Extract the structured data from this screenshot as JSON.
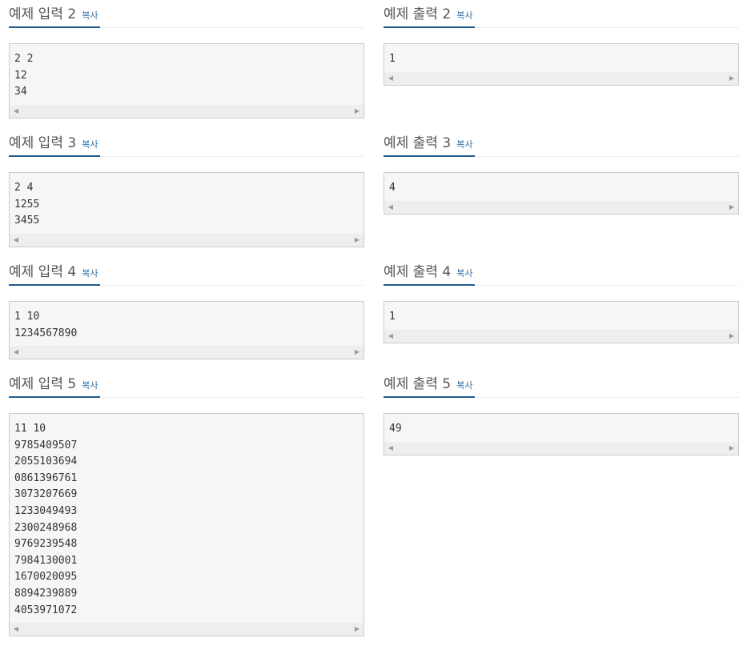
{
  "copy_label": "복사",
  "arrows": {
    "left_glyph": "◀",
    "right_glyph": "▶"
  },
  "samples": [
    {
      "input_title": "예제 입력 2",
      "output_title": "예제 출력 2",
      "input": "2 2\n12\n34",
      "output": "1"
    },
    {
      "input_title": "예제 입력 3",
      "output_title": "예제 출력 3",
      "input": "2 4\n1255\n3455",
      "output": "4"
    },
    {
      "input_title": "예제 입력 4",
      "output_title": "예제 출력 4",
      "input": "1 10\n1234567890",
      "output": "1"
    },
    {
      "input_title": "예제 입력 5",
      "output_title": "예제 출력 5",
      "input": "11 10\n9785409507\n2055103694\n0861396761\n3073207669\n1233049493\n2300248968\n9769239548\n7984130001\n1670020095\n8894239889\n4053971072",
      "output": "49"
    }
  ]
}
